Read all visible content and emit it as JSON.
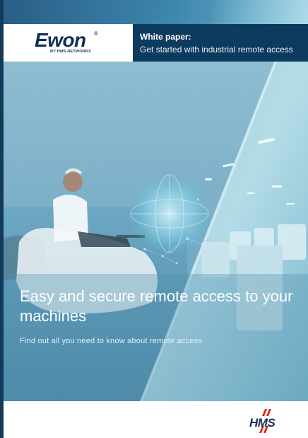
{
  "brand": {
    "name": "Ewon",
    "registered": "®",
    "tagline": "BY HMS NETWORKS"
  },
  "header": {
    "label": "White paper:",
    "title": "Get started with industrial remote access"
  },
  "hero": {
    "title": "Easy and secure remote access to your machines",
    "subtitle": "Find out all you need to know about remote access"
  },
  "footer": {
    "logo_text": "HMS",
    "logo_accent_color": "#e2231a"
  },
  "colors": {
    "navy": "#0d3a5f",
    "logo_navy": "#0e2f57",
    "hero_blue": "#6ea8c3"
  }
}
